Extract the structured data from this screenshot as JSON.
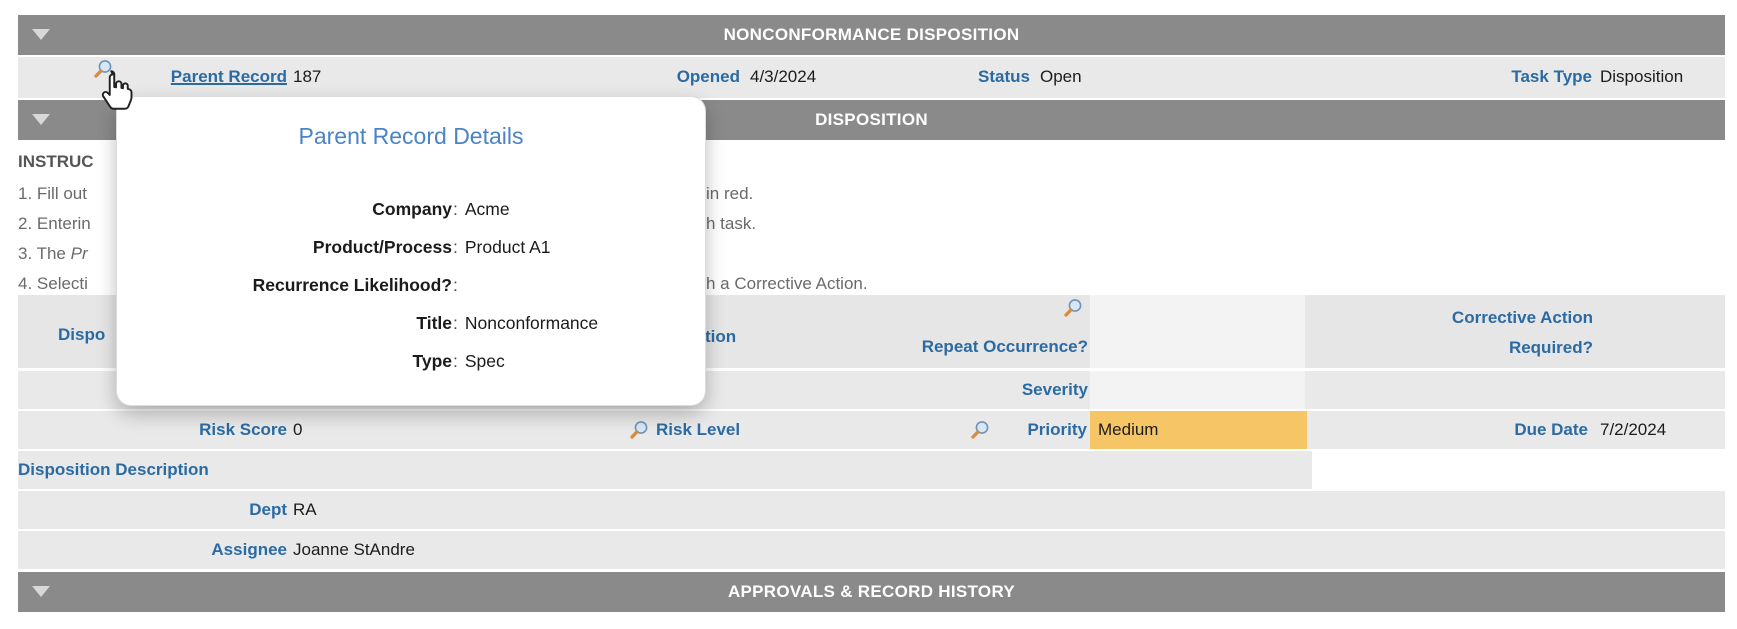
{
  "colors": {
    "section_bar_bg": "#8a8a8a",
    "label_blue": "#2b6ba3",
    "popup_title_blue": "#4a84c4",
    "highlight_orange": "#f6c666",
    "row_bg": "#e9e9e9"
  },
  "icons": {
    "collapse": "triangle-down",
    "lookup": "magnifier",
    "cursor": "hand-pointer"
  },
  "top_bar": {
    "title": "NONCONFORMANCE DISPOSITION"
  },
  "record_row": {
    "parent_record": {
      "label": "Parent Record",
      "value": "187"
    },
    "opened": {
      "label": "Opened",
      "value": "4/3/2024"
    },
    "status": {
      "label": "Status",
      "value": "Open"
    },
    "task_type": {
      "label": "Task Type",
      "value": "Disposition"
    }
  },
  "disposition_bar": {
    "title": "DISPOSITION"
  },
  "instructions": {
    "heading_fragment": "INSTRUC",
    "lines": [
      {
        "left": "1. Fill out",
        "right": "in red."
      },
      {
        "left": "2. Enterin",
        "right": "h task."
      },
      {
        "left": "3. The ",
        "left_italic": "Pr",
        "right": ""
      },
      {
        "left": "4. Selecti",
        "right": "h a Corrective Action."
      }
    ]
  },
  "grid_header": {
    "col1_fragment": "Dispo",
    "col2_fragment": "tion",
    "repeat_occurrence": "Repeat Occurrence?",
    "corrective_action_line1": "Corrective Action",
    "corrective_action_line2": "Required?"
  },
  "severity_row": {
    "label": "Severity"
  },
  "risk_row": {
    "risk_score": {
      "label": "Risk Score",
      "value": "0"
    },
    "risk_level": {
      "label": "Risk Level"
    },
    "priority": {
      "label": "Priority",
      "value": "Medium"
    },
    "due_date": {
      "label": "Due Date",
      "value": "7/2/2024"
    }
  },
  "disposition_description_row": {
    "label": "Disposition Description"
  },
  "dept_row": {
    "label": "Dept",
    "value": "RA"
  },
  "assignee_row": {
    "label": "Assignee",
    "value": "Joanne StAndre"
  },
  "approvals_bar": {
    "title": "APPROVALS & RECORD HISTORY"
  },
  "popup": {
    "title": "Parent Record Details",
    "fields": [
      {
        "label": "Company",
        "value": "Acme"
      },
      {
        "label": "Product/Process",
        "value": "Product A1"
      },
      {
        "label": "Recurrence Likelihood?",
        "value": ""
      },
      {
        "label": "Title",
        "value": "Nonconformance"
      },
      {
        "label": "Type",
        "value": "Spec"
      }
    ]
  }
}
